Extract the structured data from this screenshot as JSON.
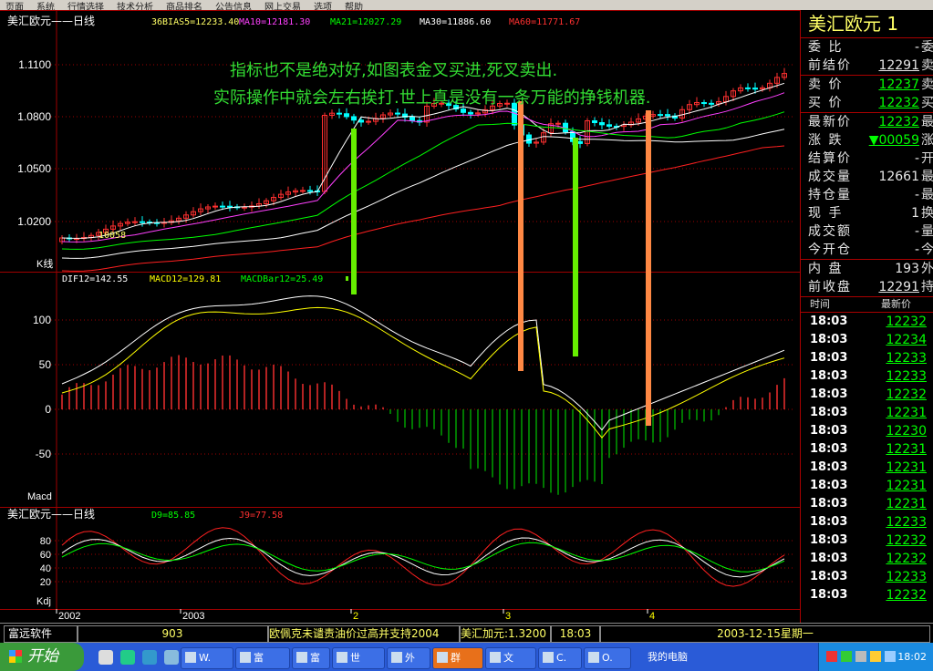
{
  "menu": [
    "页面",
    "系统",
    "行情选择",
    "技术分析",
    "商品排名",
    "公告信息",
    "网上交易",
    "选项",
    "帮助"
  ],
  "kline_header": {
    "title": "美汇欧元——日线",
    "bias": "36BIAS5=12233.40",
    "ma10": "MA10=12181.30",
    "ma21": "MA21=12027.29",
    "ma30": "MA30=11886.60",
    "ma60": "MA60=11771.67"
  },
  "price_axis": [
    "1.1100",
    "1.0800",
    "1.0500",
    "1.0200"
  ],
  "kline_axis_label": "K线",
  "low_label": "10058",
  "annotation": {
    "line1": "指标也不是绝对好,如图表金叉买进,死叉卖出.",
    "line2": "实际操作中就会左右挨打.世上真是没有一条万能的挣钱机器."
  },
  "macd_header": {
    "dif": "DIF12=142.55",
    "macd": "MACD12=129.81",
    "bar": "MACDBar12=25.49"
  },
  "macd_axis": [
    "100",
    "50",
    "0",
    "-50"
  ],
  "macd_axis_label": "Macd",
  "kdj_header": {
    "title": "美汇欧元——日线",
    "d": "D9=85.85",
    "j": "J9=77.58"
  },
  "kdj_axis": [
    "80",
    "60",
    "40",
    "20"
  ],
  "kdj_axis_label": "Kdj",
  "time_axis": [
    "2002",
    "2003",
    "2",
    "3",
    "4"
  ],
  "right_panel": {
    "title": "美汇欧元  1",
    "quotes": [
      {
        "label": "委 比",
        "value": "-",
        "edge": "委",
        "color": "#e8e8e8",
        "underline": false
      },
      {
        "label": "前结价",
        "value": "12291",
        "edge": "卖",
        "color": "#e8e8e8",
        "underline": true
      },
      {
        "label": "卖 价",
        "value": "12237",
        "edge": "卖",
        "color": "#00ff00",
        "underline": true
      },
      {
        "label": "买 价",
        "value": "12232",
        "edge": "买",
        "color": "#00ff00",
        "underline": true
      },
      {
        "label": "最新价",
        "value": "12232",
        "edge": "最",
        "color": "#00ff00",
        "underline": true
      },
      {
        "label": "涨 跌",
        "value": "▼00059",
        "edge": "涨",
        "color": "#00ff00",
        "underline": true
      },
      {
        "label": "结算价",
        "value": "-",
        "edge": "开",
        "color": "#e8e8e8",
        "underline": false
      },
      {
        "label": "成交量",
        "value": "12661",
        "edge": "最",
        "color": "#e8e8e8",
        "underline": false
      },
      {
        "label": "持仓量",
        "value": "-",
        "edge": "最",
        "color": "#e8e8e8",
        "underline": false
      },
      {
        "label": "现 手",
        "value": "1",
        "edge": "换",
        "color": "#e8e8e8",
        "underline": false
      },
      {
        "label": "成交额",
        "value": "-",
        "edge": "量",
        "color": "#e8e8e8",
        "underline": false
      },
      {
        "label": "今开仓",
        "value": "-",
        "edge": "今",
        "color": "#e8e8e8",
        "underline": false
      },
      {
        "label": "内 盘",
        "value": "193",
        "edge": "外",
        "color": "#e8e8e8",
        "underline": false
      },
      {
        "label": "前收盘",
        "value": "12291",
        "edge": "持",
        "color": "#e8e8e8",
        "underline": true
      }
    ],
    "tick_header": {
      "time": "时间",
      "price": "最新价"
    },
    "ticks": [
      {
        "time": "18:03",
        "price": "12232"
      },
      {
        "time": "18:03",
        "price": "12234"
      },
      {
        "time": "18:03",
        "price": "12233"
      },
      {
        "time": "18:03",
        "price": "12233"
      },
      {
        "time": "18:03",
        "price": "12232"
      },
      {
        "time": "18:03",
        "price": "12231"
      },
      {
        "time": "18:03",
        "price": "12230"
      },
      {
        "time": "18:03",
        "price": "12231"
      },
      {
        "time": "18:03",
        "price": "12231"
      },
      {
        "time": "18:03",
        "price": "12231"
      },
      {
        "time": "18:03",
        "price": "12231"
      },
      {
        "time": "18:03",
        "price": "12233"
      },
      {
        "time": "18:03",
        "price": "12232"
      },
      {
        "time": "18:03",
        "price": "12232"
      },
      {
        "time": "18:03",
        "price": "12233"
      },
      {
        "time": "18:03",
        "price": "12232"
      }
    ]
  },
  "status_bar": {
    "brand": "富远软件",
    "code": "903",
    "news": "欧佩克未谴责油价过高并支持2004",
    "quote": "美汇加元:1.3200",
    "time": "18:03",
    "date": "2003-12-15星期一"
  },
  "taskbar": {
    "start": "开始",
    "buttons": [
      "W.",
      "富",
      "富",
      "世",
      "外",
      "群",
      "文",
      "C.",
      "O."
    ],
    "my_computer": "我的电脑",
    "clock": "18:02"
  },
  "colors": {
    "bg": "#000000",
    "grid": "#a00000",
    "up": "#ff3030",
    "down": "#00ffff",
    "ma5": "#ffffff",
    "ma10": "#ff40ff",
    "ma21": "#00ff00",
    "ma30": "#ffffff",
    "ma60": "#ff2020",
    "dif": "#ffffff",
    "dea": "#ffff00",
    "k": "#ffffff",
    "d": "#ffff00",
    "j": "#ff2020",
    "annotation": "#33dd33",
    "marker_green": "#66ee00",
    "marker_orange": "#ff8844"
  }
}
